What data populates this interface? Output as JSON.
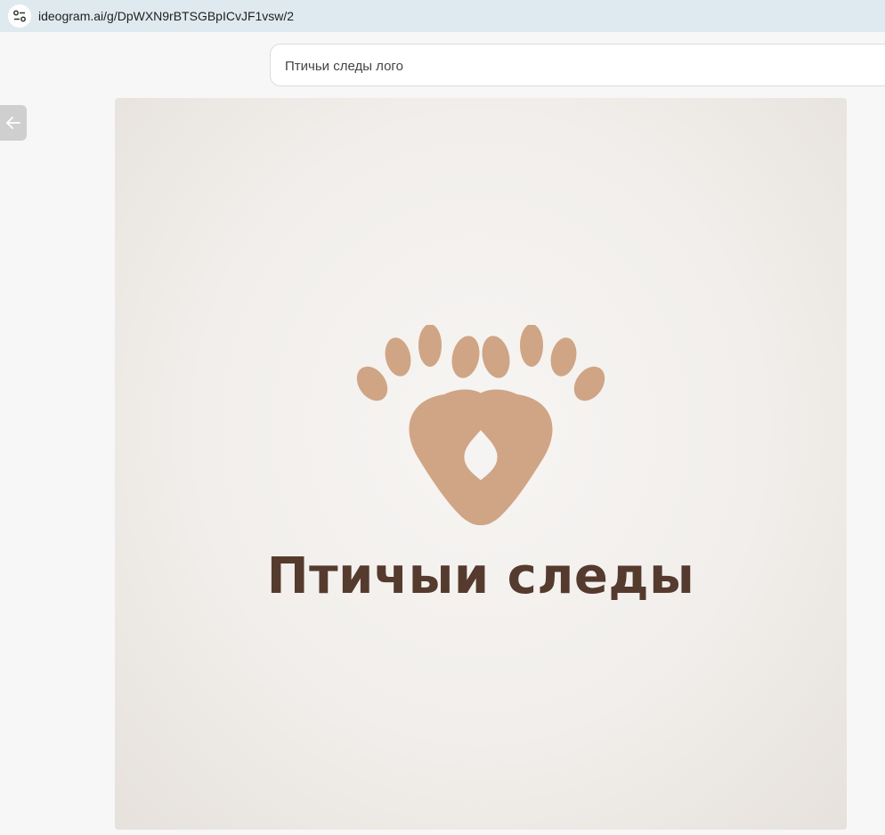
{
  "browser": {
    "url": "ideogram.ai/g/DpWXN9rBTSGBpICvJF1vsw/2",
    "site_info_icon": "tune-icon"
  },
  "search": {
    "prompt_text": "Птичьи следы лого"
  },
  "navigation": {
    "back_icon": "arrow-left-icon"
  },
  "image": {
    "logo_text": "Птичыи следы",
    "colors": {
      "footprint": "#cfa585",
      "text": "#553a2e",
      "background": "#f3f0ed"
    }
  }
}
